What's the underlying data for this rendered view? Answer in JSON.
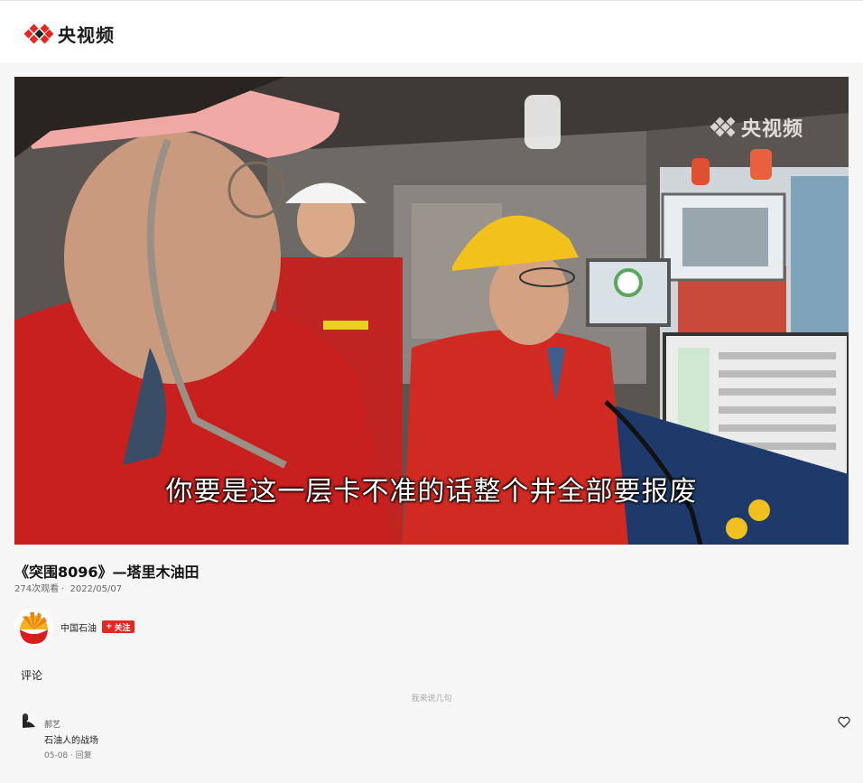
{
  "brand": {
    "name": "央视频",
    "color": "#e32722"
  },
  "video": {
    "subtitle": "你要是这一层卡不准的话整个井全部要报废",
    "watermark": "央视频"
  },
  "info": {
    "title": "《突围8096》—塔里木油田",
    "views": "274次观看",
    "separator": "·",
    "date": "2022/05/07"
  },
  "channel": {
    "name": "中国石油",
    "follow_plus": "+",
    "follow_label": "关注",
    "avatar_icon": "petrochina-logo-icon"
  },
  "comments": {
    "header": "评论",
    "input_placeholder": "我来说几句",
    "items": [
      {
        "user": "郝艺",
        "text": "石油人的战场",
        "time": "05-08",
        "separator": "·",
        "reply_label": "回复",
        "like_icon": "heart-icon"
      }
    ]
  }
}
